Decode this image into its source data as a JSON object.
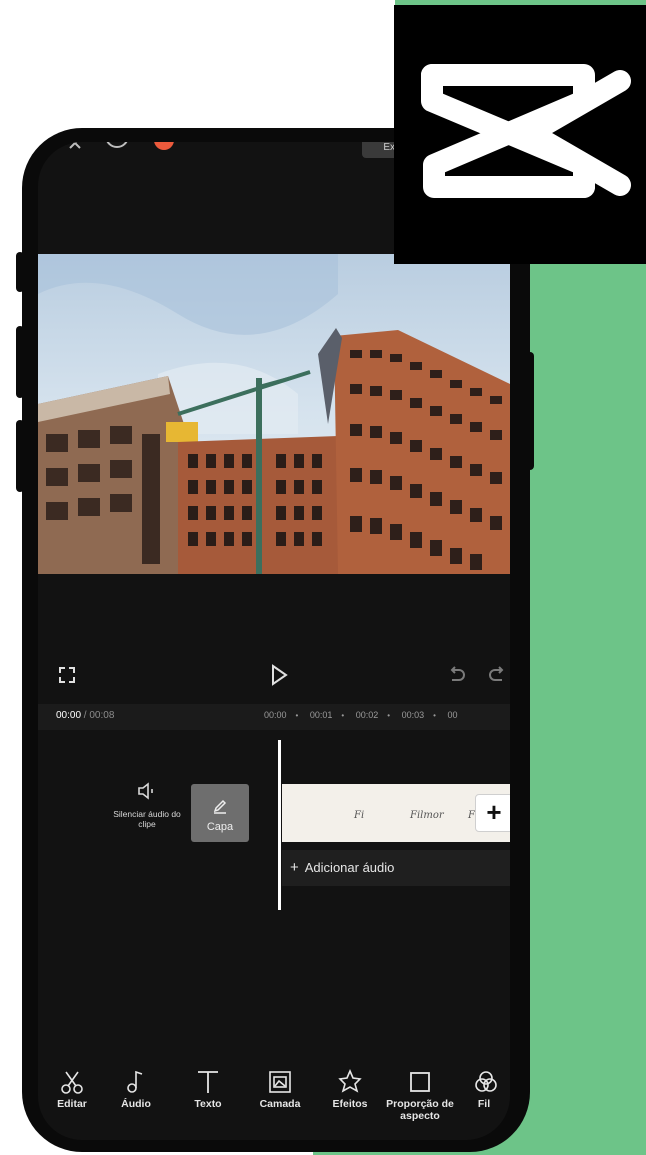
{
  "colors": {
    "background_band": "#6dc488",
    "phone_body": "#0a0a0a",
    "logo_bg": "#000000",
    "logo_fg": "#ffffff",
    "record_dot": "#ec5a3c"
  },
  "topbar": {
    "close_icon": "close-icon",
    "help_icon": "help-icon",
    "export_label": "Exp"
  },
  "preview": {
    "image": "construction-site-photo"
  },
  "controls": {
    "fullscreen_icon": "fullscreen-icon",
    "play_icon": "play-icon",
    "undo_icon": "undo-icon",
    "redo_icon": "redo-icon"
  },
  "timeline": {
    "current_time": "00:00",
    "total_time": " / 00:08",
    "ruler": [
      "00:00",
      "00:01",
      "00:02",
      "00:03",
      "00"
    ]
  },
  "tracks": {
    "mute_label": "Silenciar áudio do clipe",
    "cover_label": "Capa",
    "add_clip_label": "+",
    "add_audio_label": "Adicionar áudio",
    "clip_texts": [
      "Fi",
      "Filmor",
      "Fi"
    ]
  },
  "toolbar": {
    "items": [
      {
        "label": "Editar",
        "icon": "scissors-icon"
      },
      {
        "label": "Áudio",
        "icon": "music-note-icon"
      },
      {
        "label": "Texto",
        "icon": "text-icon"
      },
      {
        "label": "Camada",
        "icon": "layer-icon"
      },
      {
        "label": "Efeitos",
        "icon": "effects-icon"
      },
      {
        "label": "Proporção de aspecto",
        "icon": "aspect-ratio-icon"
      },
      {
        "label": "Fil",
        "icon": "filters-icon"
      }
    ]
  },
  "logo": {
    "name": "capcut-logo"
  }
}
